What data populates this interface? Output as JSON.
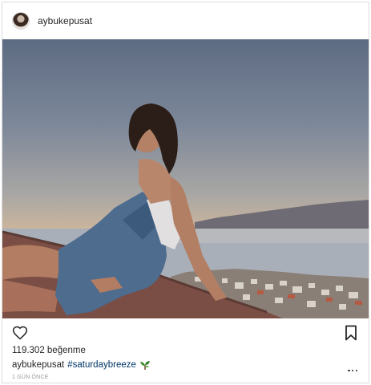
{
  "post": {
    "username": "aybukepusat",
    "likes_text": "119.302 beğenme",
    "caption": {
      "username": "aybukepusat",
      "hashtag": "#saturdaybreeze",
      "emoji_icon": "plant-emoji-icon"
    },
    "time_text": "1 GÜN ÖNCE"
  },
  "icons": {
    "like": "heart-outline-icon",
    "save": "bookmark-outline-icon",
    "more": "ellipsis-icon"
  },
  "colors": {
    "text": "#262626",
    "hashtag": "#003569",
    "muted": "#999999",
    "border": "#dbdbdb"
  }
}
